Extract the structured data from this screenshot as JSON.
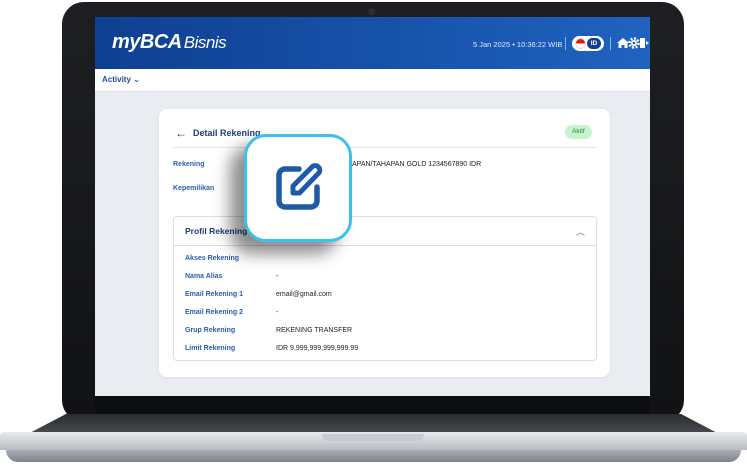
{
  "header": {
    "logo_main": "myBCA",
    "logo_sub": "Bisnis",
    "datetime": "5 Jan 2025 • 10:36:22 WIB",
    "language_code": "ID"
  },
  "nav": {
    "activity_label": "Activity"
  },
  "detail": {
    "title": "Detail Rekening",
    "status": "Aktif",
    "rows": [
      {
        "label": "Rekening",
        "value": "APAN/TAHAPAN GOLD 1234567890 IDR"
      },
      {
        "label": "Kepemilikan",
        "value": ""
      }
    ]
  },
  "profil": {
    "title": "Profil Rekening",
    "rows": [
      {
        "label": "Akses Rekening",
        "value": ""
      },
      {
        "label": "Nama Alias",
        "value": "-"
      },
      {
        "label": "Email Rekening 1",
        "value": "email@gmail.com"
      },
      {
        "label": "Email Rekening 2",
        "value": "-"
      },
      {
        "label": "Grup Rekening",
        "value": "REKENING TRANSFER"
      },
      {
        "label": "Limit Rekening",
        "value": "IDR 9,999,999,999,999.99"
      }
    ]
  },
  "colors": {
    "brand_blue": "#0e3f91",
    "accent_cyan": "#3cc0ec",
    "status_green": "#1f8a3b"
  },
  "icons": [
    "back-arrow-icon",
    "home-icon",
    "gear-icon",
    "logout-icon",
    "chevron-down-icon",
    "chevron-up-icon",
    "edit-icon"
  ]
}
